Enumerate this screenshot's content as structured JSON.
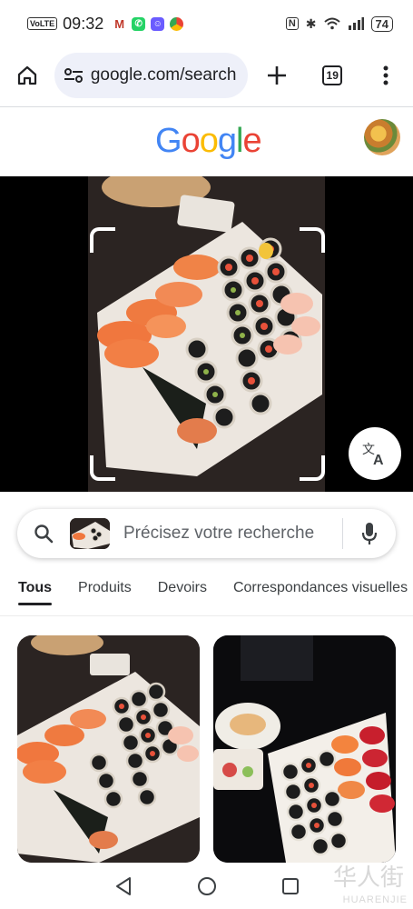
{
  "status_bar": {
    "volte": "VoLTE",
    "time": "09:32",
    "nfc": "N",
    "battery": "74"
  },
  "browser": {
    "url": "google.com/search",
    "tab_count": "19"
  },
  "google": {
    "logo": [
      "G",
      "o",
      "o",
      "g",
      "l",
      "e"
    ],
    "logo_colors": [
      "#4285F4",
      "#EA4335",
      "#FBBC05",
      "#4285F4",
      "#34A853",
      "#EA4335"
    ]
  },
  "search": {
    "placeholder": "Précisez votre recherche"
  },
  "tabs": [
    {
      "label": "Tous"
    },
    {
      "label": "Produits"
    },
    {
      "label": "Devoirs"
    },
    {
      "label": "Correspondances visuelles"
    }
  ],
  "watermark": {
    "cn": "华人街",
    "en": "HUARENJIE"
  },
  "colors": {
    "accent": "#202124",
    "pill_bg": "#eef0f9"
  }
}
